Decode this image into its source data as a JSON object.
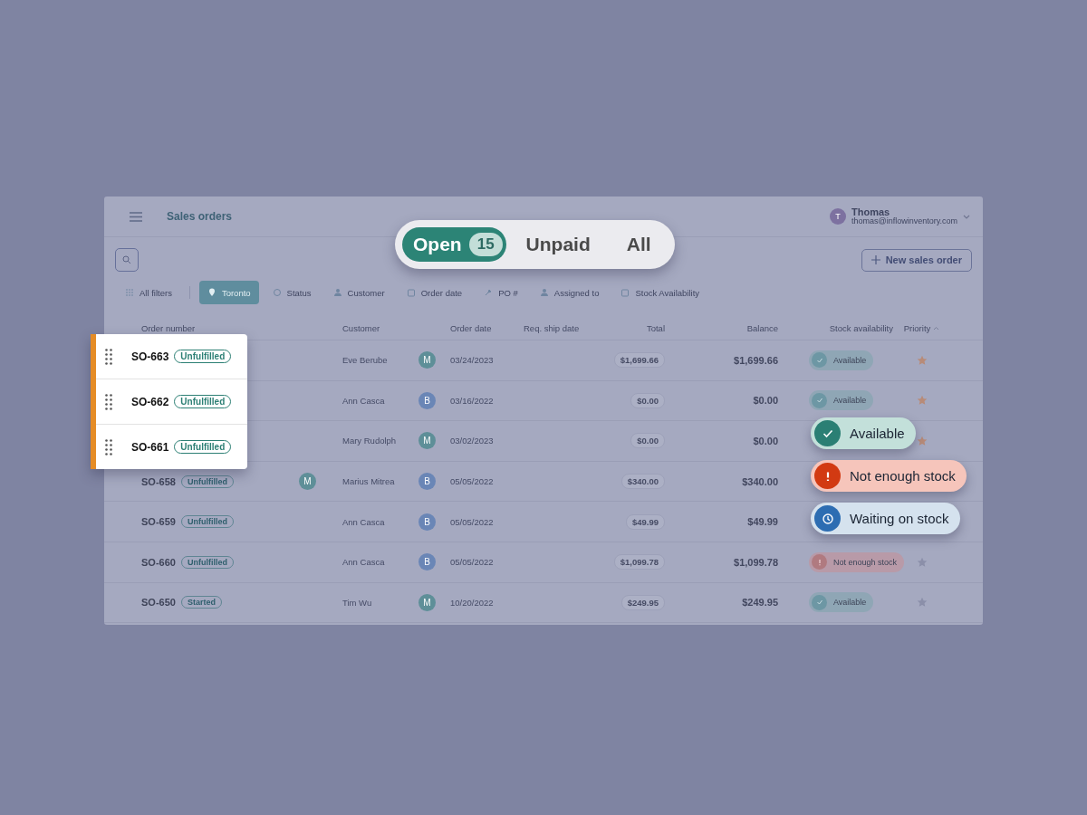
{
  "header": {
    "title": "Sales orders",
    "user": {
      "initial": "T",
      "name": "Thomas",
      "email": "thomas@inflowinventory.com"
    }
  },
  "view_tabs": [
    {
      "label": "Open",
      "count": "15",
      "selected": true
    },
    {
      "label": "Unpaid",
      "selected": false
    },
    {
      "label": "All",
      "selected": false
    }
  ],
  "new_button": "New sales order",
  "filters": [
    {
      "label": "All filters",
      "selected": false
    },
    {
      "label": "Toronto",
      "selected": true
    },
    {
      "label": "Status",
      "selected": false
    },
    {
      "label": "Customer",
      "selected": false
    },
    {
      "label": "Order date",
      "selected": false
    },
    {
      "label": "PO #",
      "selected": false
    },
    {
      "label": "Assigned to",
      "selected": false
    },
    {
      "label": "Stock Availability",
      "selected": false
    }
  ],
  "columns": [
    "Order number",
    "Customer",
    "Order date",
    "Req. ship date",
    "Total",
    "Balance",
    "Stock availability",
    "Priority"
  ],
  "rows": [
    {
      "customer": "Eve Berube",
      "avatar": {
        "initial": "M",
        "color": "#5e8f98"
      },
      "order_date": "03/24/2023",
      "total": "$1,699.66",
      "balance": "$1,699.66",
      "stock": {
        "kind": "available",
        "label": "Available"
      },
      "starred": true
    },
    {
      "customer": "Ann Casca",
      "avatar": {
        "initial": "B",
        "color": "#6a86b6"
      },
      "order_date": "03/16/2022",
      "total": "$0.00",
      "balance": "$0.00",
      "stock": {
        "kind": "available",
        "label": "Available"
      },
      "starred": true
    },
    {
      "customer": "Mary Rudolph",
      "avatar": {
        "initial": "M",
        "color": "#5e8f98"
      },
      "order_date": "03/02/2023",
      "total": "$0.00",
      "balance": "$0.00",
      "starred": true
    },
    {
      "order_number": "SO-658",
      "status": "Unfulfilled",
      "assignee": {
        "initial": "M",
        "color": "#5e8f98"
      },
      "customer": "Marius Mitrea",
      "avatar": {
        "initial": "B",
        "color": "#6a86b6"
      },
      "order_date": "05/05/2022",
      "total": "$340.00",
      "balance": "$340.00"
    },
    {
      "order_number": "SO-659",
      "status": "Unfulfilled",
      "customer": "Ann Casca",
      "avatar": {
        "initial": "B",
        "color": "#6a86b6"
      },
      "order_date": "05/05/2022",
      "total": "$49.99",
      "balance": "$49.99"
    },
    {
      "order_number": "SO-660",
      "status": "Unfulfilled",
      "customer": "Ann Casca",
      "avatar": {
        "initial": "B",
        "color": "#6a86b6"
      },
      "order_date": "05/05/2022",
      "total": "$1,099.78",
      "balance": "$1,099.78",
      "stock": {
        "kind": "short",
        "label": "Not enough stock"
      },
      "starred": false
    },
    {
      "order_number": "SO-650",
      "status": "Started",
      "customer": "Tim Wu",
      "avatar": {
        "initial": "M",
        "color": "#5e8f98"
      },
      "order_date": "10/20/2022",
      "total": "$249.95",
      "balance": "$249.95",
      "stock": {
        "kind": "available",
        "label": "Available"
      },
      "starred": false
    }
  ],
  "floating_rows": [
    {
      "order_number": "SO-663",
      "status": "Unfulfilled"
    },
    {
      "order_number": "SO-662",
      "status": "Unfulfilled"
    },
    {
      "order_number": "SO-661",
      "status": "Unfulfilled"
    }
  ],
  "stock_badges": [
    {
      "kind": "available",
      "label": "Available"
    },
    {
      "kind": "short",
      "label": "Not enough stock"
    },
    {
      "kind": "waiting",
      "label": "Waiting on stock"
    }
  ]
}
